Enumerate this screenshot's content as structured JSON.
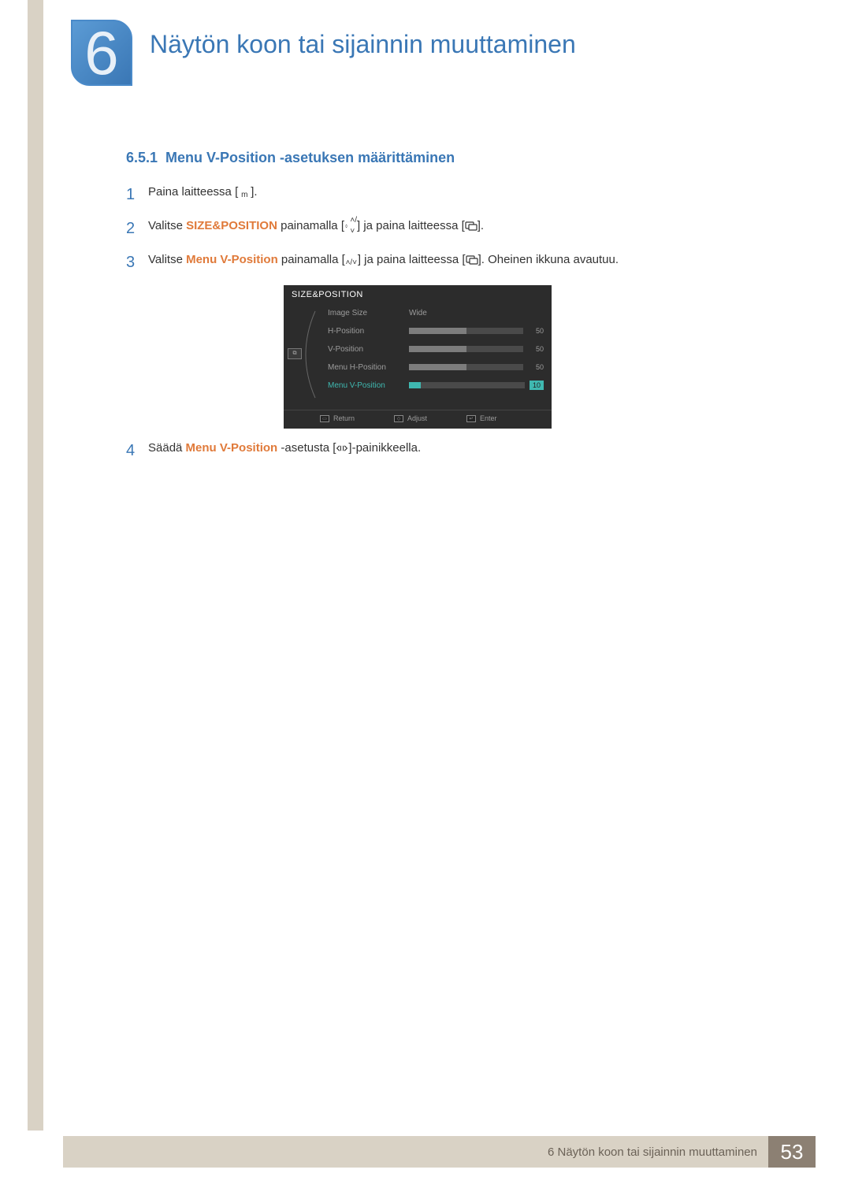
{
  "chapter": {
    "number": "6",
    "title": "Näytön koon tai sijainnin muuttaminen"
  },
  "section": {
    "number": "6.5.1",
    "title": "Menu V-Position -asetuksen määrittäminen"
  },
  "steps": {
    "s1": {
      "num": "1",
      "t1": "Paina laitteessa [",
      "t2": "]."
    },
    "s2": {
      "num": "2",
      "t1": "Valitse ",
      "hl": "SIZE&POSITION",
      "t2": " painamalla [",
      "t3": "] ja paina laitteessa [",
      "t4": "]."
    },
    "s3": {
      "num": "3",
      "t1": "Valitse ",
      "hl": "Menu V-Position",
      "t2": " painamalla [",
      "t3": "] ja paina laitteessa [",
      "t4": "]. Oheinen ikkuna avautuu."
    },
    "s4": {
      "num": "4",
      "t1": "Säädä ",
      "hl": "Menu V-Position",
      "t2": " -asetusta [",
      "t3": "]-painikkeella."
    }
  },
  "osd": {
    "title": "SIZE&POSITION",
    "rows": {
      "r0": {
        "label": "Image Size",
        "text": "Wide"
      },
      "r1": {
        "label": "H-Position",
        "value": "50",
        "pct": 50
      },
      "r2": {
        "label": "V-Position",
        "value": "50",
        "pct": 50
      },
      "r3": {
        "label": "Menu H-Position",
        "value": "50",
        "pct": 50
      },
      "r4": {
        "label": "Menu V-Position",
        "value": "10",
        "pct": 10
      }
    },
    "footer": {
      "return": "Return",
      "adjust": "Adjust",
      "enter": "Enter"
    }
  },
  "footer": {
    "text": "6 Näytön koon tai sijainnin muuttaminen",
    "page": "53"
  }
}
